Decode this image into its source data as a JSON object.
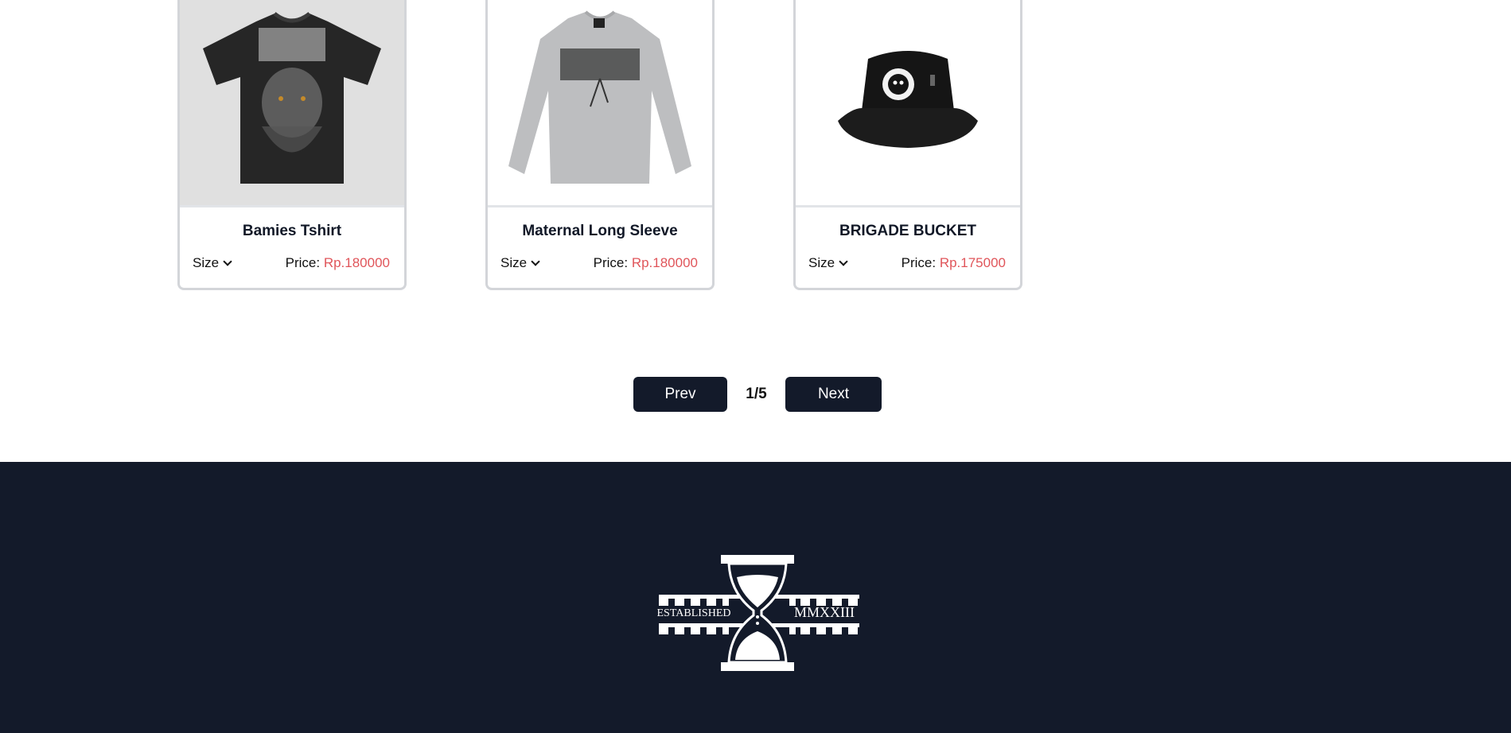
{
  "products": [
    {
      "name": "Bamies Tshirt",
      "size_label": "Size",
      "price_label": "Price:",
      "price_value": "Rp.180000",
      "image_icon": "black-graphic-tshirt"
    },
    {
      "name": "Maternal Long Sleeve",
      "size_label": "Size",
      "price_label": "Price:",
      "price_value": "Rp.180000",
      "image_icon": "grey-long-sleeve-shirt"
    },
    {
      "name": "BRIGADE BUCKET",
      "size_label": "Size",
      "price_label": "Price:",
      "price_value": "Rp.175000",
      "image_icon": "black-bucket-hat"
    }
  ],
  "pagination": {
    "prev_label": "Prev",
    "page_indicator": "1/5",
    "next_label": "Next"
  },
  "footer": {
    "logo_left_text": "ESTABLISHED",
    "logo_right_text": "MMXXIII",
    "background_color": "#131a2a"
  },
  "colors": {
    "accent_dark": "#131a2a",
    "price_red": "#e0555a"
  }
}
